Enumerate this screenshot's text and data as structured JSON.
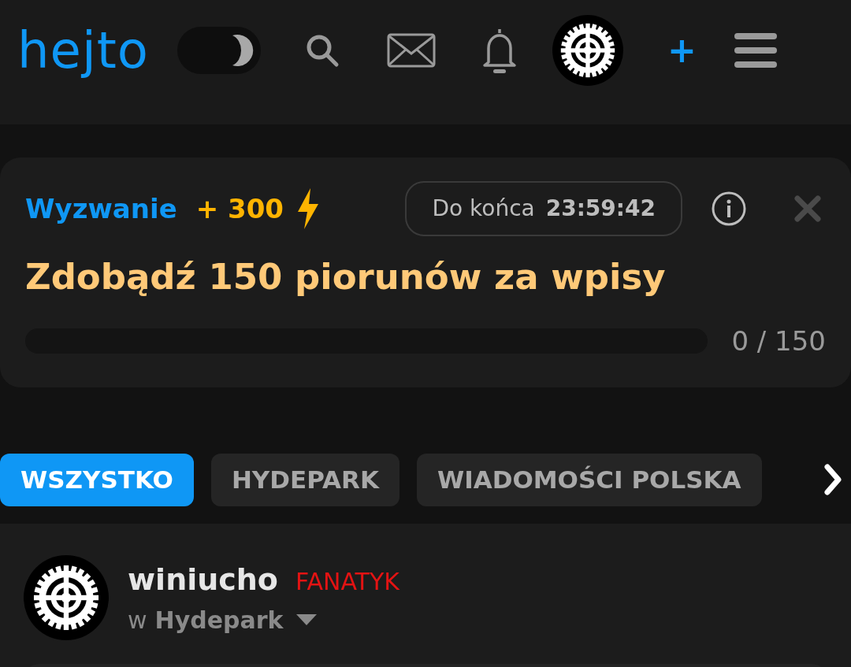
{
  "header": {
    "logo": "hejto",
    "dark_mode": true,
    "add_label": "+"
  },
  "challenge": {
    "label": "Wyzwanie",
    "reward": "+ 300",
    "timer_label": "Do końca",
    "timer": "23:59:42",
    "title": "Zdobądź 150 piorunów za wpisy",
    "level": 0,
    "progress_text": "0 / 150"
  },
  "tabs": [
    {
      "label": "WSZYSTKO",
      "selected": true
    },
    {
      "label": "HYDEPARK",
      "selected": false
    },
    {
      "label": "WIADOMOŚCI POLSKA",
      "selected": false
    }
  ],
  "post": {
    "author": "winiucho",
    "rank": "FANATYK",
    "in_label": "w",
    "community": "Hydepark"
  }
}
